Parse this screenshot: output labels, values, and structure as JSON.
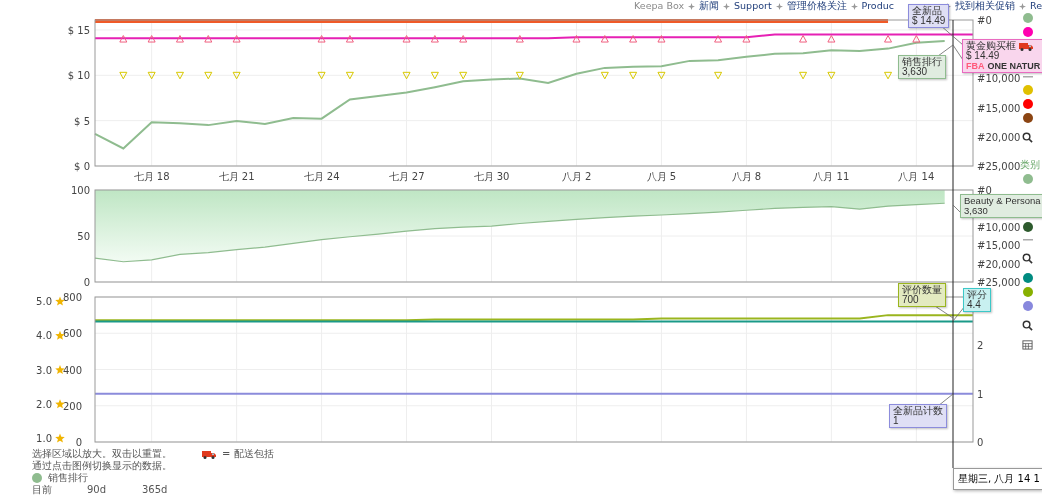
{
  "nav": [
    {
      "label": "Keepa Box",
      "kind": "text"
    },
    {
      "label": "新闻",
      "kind": "link"
    },
    {
      "label": "Support",
      "kind": "link"
    },
    {
      "label": "管理价格关注",
      "kind": "link"
    },
    {
      "label": "Produc",
      "kind": "link"
    },
    {
      "label": "找到相关促销",
      "kind": "link"
    },
    {
      "label": "Re",
      "kind": "link"
    }
  ],
  "charts": [
    {
      "chart_data": {
        "type": "line",
        "grid": true,
        "categories": [
          null,
          null,
          "七月 18",
          null,
          null,
          "七月 21",
          null,
          null,
          "七月 24",
          null,
          null,
          "七月 27",
          null,
          null,
          "七月 30",
          null,
          null,
          "八月 2",
          null,
          null,
          "八月 5",
          null,
          null,
          "八月 8",
          null,
          null,
          "八月 11",
          null,
          null,
          "八月 14",
          null,
          null
        ],
        "ylim": [
          0,
          16.1
        ],
        "yticks": [
          {
            "value": 0,
            "label": "$ 0"
          },
          {
            "value": 5,
            "label": "$ 5"
          },
          {
            "value": 10,
            "label": "$ 10"
          },
          {
            "value": 15,
            "label": "$ 15"
          }
        ],
        "y2lim": [
          25000,
          0
        ],
        "y2ticks": [
          {
            "value": 0,
            "label": "#0"
          },
          {
            "value": 10000,
            "label": "#10,000"
          },
          {
            "value": 15000,
            "label": "#15,000"
          },
          {
            "value": 20000,
            "label": "#20,000"
          },
          {
            "value": 25000,
            "label": "#25,000"
          }
        ],
        "series": [
          {
            "color": "#f05a28",
            "values": [
              16,
              16,
              16,
              16,
              16,
              16,
              16,
              16,
              16,
              16,
              16,
              16,
              16,
              16,
              16,
              16,
              16,
              16,
              16,
              16,
              16,
              16,
              16,
              16,
              16,
              16,
              16,
              16,
              16,
              null,
              null,
              null
            ]
          },
          {
            "color": "#e620b4",
            "values": [
              14.1,
              14.1,
              14.1,
              14.1,
              14.1,
              14.1,
              14.1,
              14.1,
              14.1,
              14.1,
              14.1,
              14.1,
              14.1,
              14.1,
              14.1,
              14.1,
              14.1,
              14.2,
              14.2,
              14.2,
              14.2,
              14.2,
              14.2,
              14.2,
              14.5,
              14.5,
              14.5,
              14.5,
              14.5,
              14.5,
              14.5,
              14.5
            ]
          },
          {
            "axis": "y2",
            "color": "#8fbc8f",
            "values": [
              19500,
              22000,
              17500,
              17700,
              18000,
              17300,
              17800,
              16800,
              16900,
              13600,
              13000,
              12400,
              11500,
              10500,
              10200,
              10000,
              10800,
              9200,
              8200,
              8000,
              7900,
              7000,
              6900,
              6300,
              5800,
              5700,
              5200,
              5300,
              4900,
              3900,
              3600,
              null
            ]
          },
          {
            "type": "scatter",
            "marker": "triangle-up",
            "color": "#f06080",
            "values": [
              null,
              14,
              14,
              14,
              14,
              14,
              null,
              null,
              14,
              14,
              null,
              14,
              14,
              14,
              null,
              14,
              null,
              14,
              14,
              14,
              14,
              null,
              14,
              14,
              null,
              14,
              14,
              null,
              14,
              14,
              null,
              null
            ]
          },
          {
            "type": "scatter",
            "marker": "triangle-down",
            "color": "#d8c800",
            "values": [
              null,
              10,
              10,
              10,
              10,
              10,
              null,
              null,
              10,
              10,
              null,
              10,
              10,
              10,
              null,
              10,
              null,
              null,
              10,
              10,
              10,
              null,
              10,
              null,
              null,
              10,
              10,
              null,
              10,
              null,
              null,
              null
            ]
          }
        ]
      }
    },
    {
      "chart_data": {
        "type": "area",
        "grid": true,
        "categories": [
          null,
          null,
          null,
          null,
          null,
          null,
          null,
          null,
          null,
          null,
          null,
          null,
          null,
          null,
          null,
          null,
          null,
          null,
          null,
          null,
          null,
          null,
          null,
          null,
          null,
          null,
          null,
          null,
          null,
          null,
          null,
          null
        ],
        "ylim": [
          0,
          100
        ],
        "yticks": [
          {
            "value": 0,
            "label": "0"
          },
          {
            "value": 50,
            "label": "50"
          },
          {
            "value": 100,
            "label": "100"
          }
        ],
        "y2lim": [
          25000,
          0
        ],
        "y2ticks": [
          {
            "value": 0,
            "label": "#0"
          },
          {
            "value": 10000,
            "label": "#10,000"
          },
          {
            "value": 15000,
            "label": "#15,000"
          },
          {
            "value": 20000,
            "label": "#20,000"
          },
          {
            "value": 25000,
            "label": "#25,000"
          }
        ],
        "series": [
          {
            "axis": "y2",
            "color": "#8fbc8f",
            "values": [
              18500,
              19500,
              19000,
              17500,
              17000,
              16200,
              15500,
              14500,
              13500,
              12700,
              12000,
              11200,
              10500,
              10100,
              9800,
              9100,
              8500,
              8000,
              7500,
              7100,
              6800,
              6400,
              6000,
              5500,
              5000,
              4700,
              4500,
              5200,
              4400,
              4000,
              3600,
              null
            ]
          }
        ]
      }
    },
    {
      "chart_data": {
        "type": "line",
        "grid": true,
        "categories": [
          null,
          null,
          null,
          null,
          null,
          null,
          null,
          null,
          null,
          null,
          null,
          null,
          null,
          null,
          null,
          null,
          null,
          null,
          null,
          null,
          null,
          null,
          null,
          null,
          null,
          null,
          null,
          null,
          null,
          null,
          null,
          null
        ],
        "ylim": [
          0,
          800
        ],
        "yticks": [
          {
            "value": 0,
            "label": "0"
          },
          {
            "value": 200,
            "label": "200"
          },
          {
            "value": 400,
            "label": "400"
          },
          {
            "value": 600,
            "label": "600"
          },
          {
            "value": 800,
            "label": "800"
          }
        ],
        "y2lim": [
          0,
          3
        ],
        "y2ticks": [
          {
            "value": 0,
            "label": "0"
          },
          {
            "value": 1,
            "label": "1"
          },
          {
            "value": 2,
            "label": "2"
          }
        ],
        "y3lim": [
          0.883,
          5.117
        ],
        "y3ticks": [
          {
            "value": 1,
            "label": "1.0"
          },
          {
            "value": 2,
            "label": "2.0"
          },
          {
            "value": 3,
            "label": "3.0"
          },
          {
            "value": 4,
            "label": "4.0"
          },
          {
            "value": 5,
            "label": "5.0"
          }
        ],
        "series": [
          {
            "color": "#9ab51e",
            "values": [
              672,
              672,
              672,
              672,
              672,
              672,
              672,
              672,
              672,
              672,
              672,
              672,
              676,
              676,
              676,
              676,
              676,
              676,
              676,
              676,
              682,
              682,
              682,
              682,
              682,
              682,
              682,
              682,
              700,
              700,
              700,
              700
            ]
          },
          {
            "axis": "y3",
            "color": "#1a9a88",
            "values": [
              4.4,
              4.4,
              4.4,
              4.4,
              4.4,
              4.4,
              4.4,
              4.4,
              4.4,
              4.4,
              4.4,
              4.4,
              4.4,
              4.4,
              4.4,
              4.4,
              4.4,
              4.4,
              4.4,
              4.4,
              4.4,
              4.4,
              4.4,
              4.4,
              4.4,
              4.4,
              4.4,
              4.4,
              4.4,
              4.4,
              4.4,
              4.4
            ]
          },
          {
            "axis": "y2",
            "color": "#8b8bdb",
            "values": [
              1,
              1,
              1,
              1,
              1,
              1,
              1,
              1,
              1,
              1,
              1,
              1,
              1,
              1,
              1,
              1,
              1,
              1,
              1,
              1,
              1,
              1,
              1,
              1,
              1,
              1,
              1,
              1,
              1,
              1,
              1,
              1
            ]
          }
        ]
      }
    }
  ],
  "tooltips": [
    {
      "title": "全新品",
      "value": "$ 14.49",
      "color": "#8c8cdc"
    },
    {
      "title": "销售排行",
      "value": "3,630",
      "color": "#8fbc8f"
    },
    {
      "title": "黄金购买框",
      "value": "$ 14.49",
      "badge": "FBA",
      "seller": "ONE NATUR",
      "shipping_included": true,
      "color": "#e96bc0"
    },
    {
      "title": "Beauty & Persona",
      "value": "3,630",
      "color": "#8fbc8f"
    },
    {
      "title": "评价数量",
      "value": "700",
      "color": "#9ab51e"
    },
    {
      "title": "评分",
      "value": "4.4",
      "color": "#3cc8c8"
    },
    {
      "title": "全新品计数",
      "value": "1",
      "color": "#8c8cdc"
    }
  ],
  "hover_date": "星期三, 八月 14 1",
  "legend": [
    {
      "kind": "dot",
      "color": "#8fbc8f"
    },
    {
      "kind": "dot",
      "color": "#ff00b0"
    },
    {
      "kind": "gap"
    },
    {
      "kind": "dash"
    },
    {
      "kind": "dot",
      "color": "#e0c000"
    },
    {
      "kind": "dot",
      "color": "#ff0000"
    },
    {
      "kind": "dot",
      "color": "#8b4513"
    },
    {
      "kind": "search"
    },
    {
      "kind": "header",
      "label": "类别"
    },
    {
      "kind": "dot",
      "color": "#8fbc8f"
    },
    {
      "kind": "gap"
    },
    {
      "kind": "dot",
      "color": "#2d5a2d"
    },
    {
      "kind": "dash"
    },
    {
      "kind": "search"
    },
    {
      "kind": "dot",
      "color": "#008b80"
    },
    {
      "kind": "dot",
      "color": "#88b000"
    },
    {
      "kind": "dot",
      "color": "#8888dd"
    },
    {
      "kind": "search"
    },
    {
      "kind": "calendar"
    }
  ],
  "notes": [
    "选择区域以放大。双击以重置。",
    "通过点击图例切换显示的数据。"
  ],
  "shipping_note": "= 配送包括",
  "stats": {
    "label": "销售排行",
    "color": "#8fbc8f",
    "columns": [
      "目前",
      "90d",
      "365d"
    ]
  }
}
